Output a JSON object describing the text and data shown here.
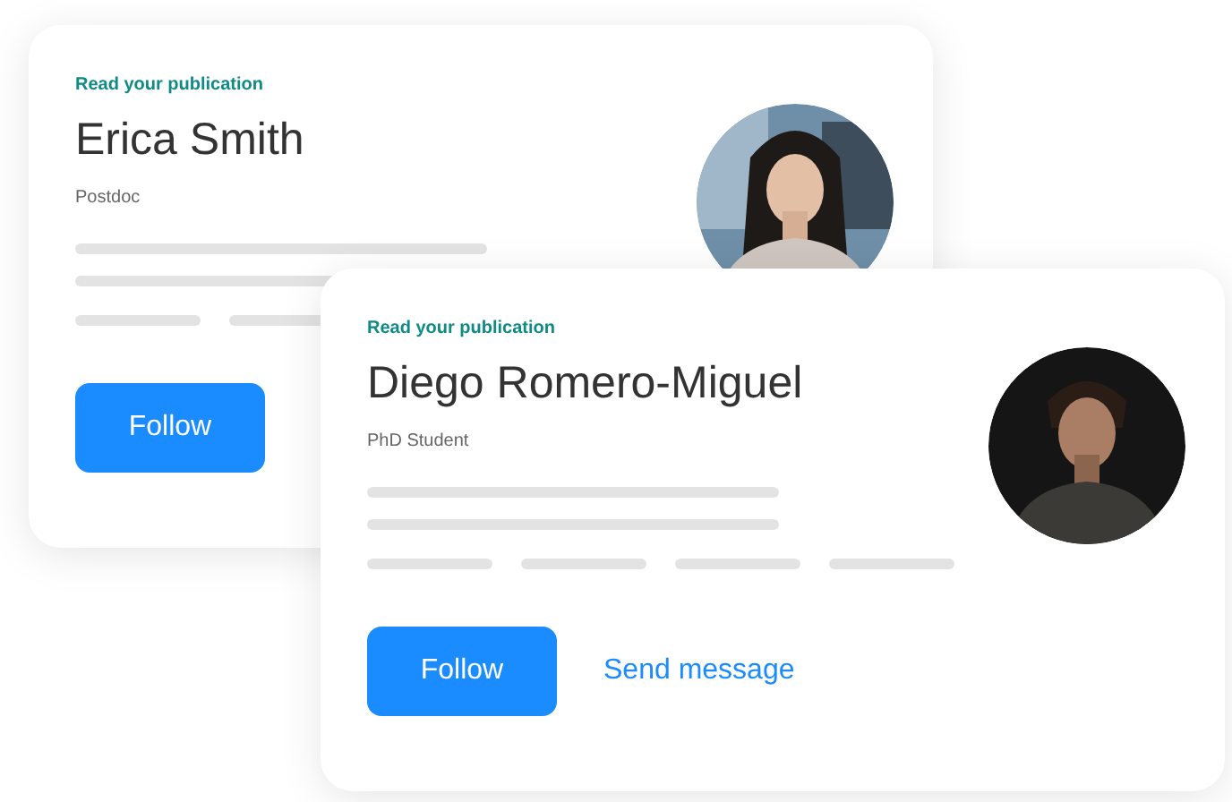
{
  "cards": [
    {
      "eyebrow": "Read your publication",
      "name": "Erica Smith",
      "role": "Postdoc",
      "follow": "Follow"
    },
    {
      "eyebrow": "Read your publication",
      "name": "Diego Romero-Miguel",
      "role": "PhD Student",
      "follow": "Follow",
      "message": "Send message"
    }
  ]
}
